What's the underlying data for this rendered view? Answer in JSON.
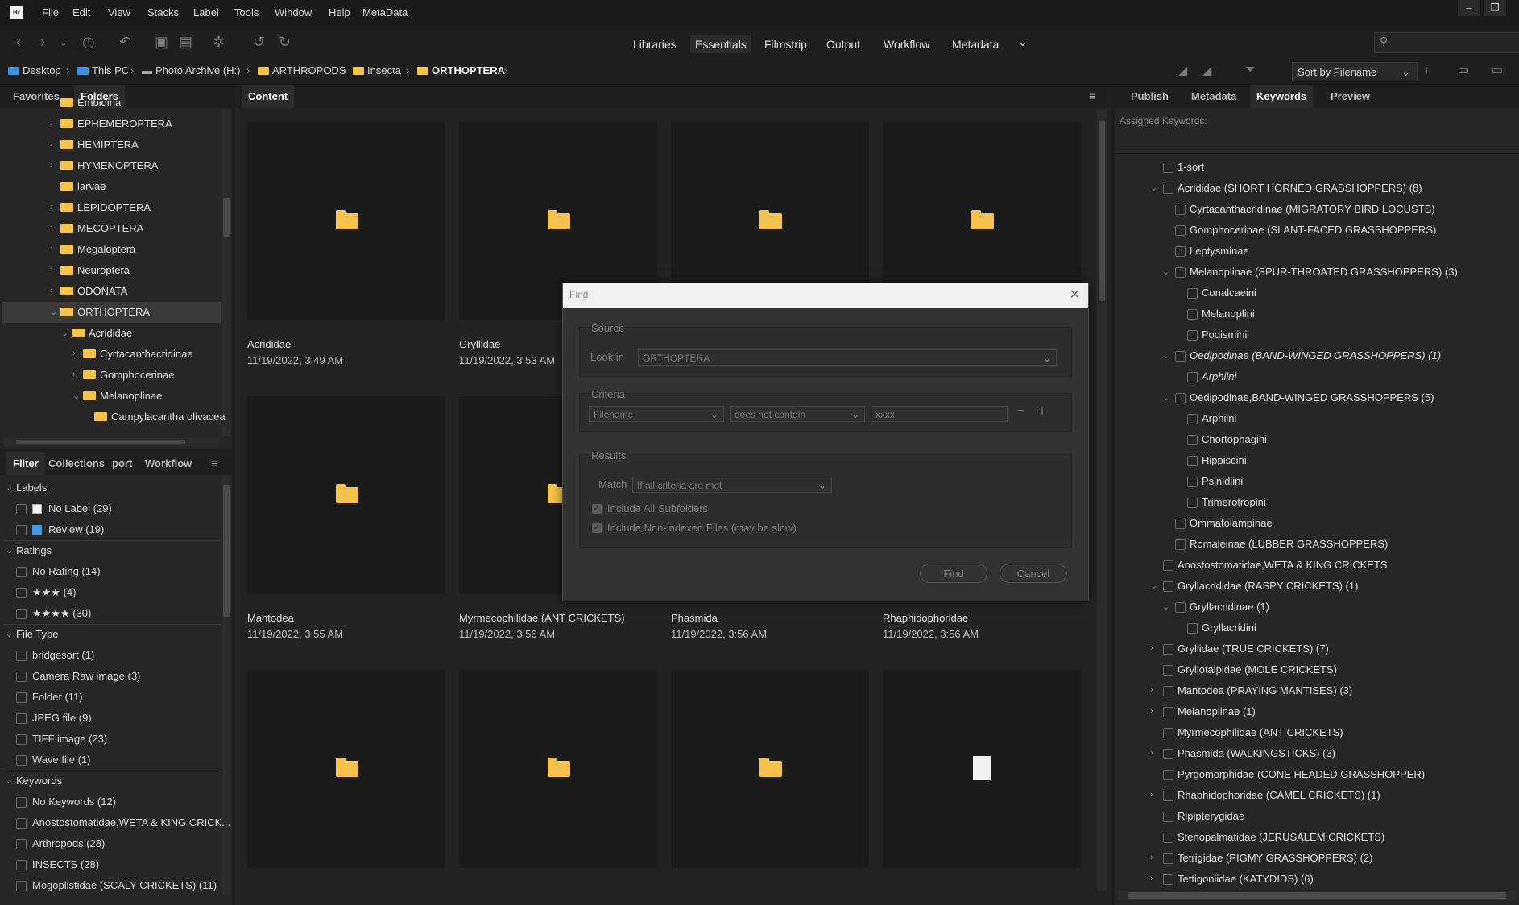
{
  "menu": [
    "File",
    "Edit",
    "View",
    "Stacks",
    "Label",
    "Tools",
    "Window",
    "Help",
    "MetaData"
  ],
  "app_logo": "Br",
  "workspaces": [
    "Libraries",
    "Essentials",
    "Filmstrip",
    "Output",
    "Workflow",
    "Metadata"
  ],
  "active_workspace": "Essentials",
  "breadcrumb": [
    "Desktop",
    "This PC",
    "Photo Archive (H:)",
    "ARTHROPODS",
    "Insecta",
    "ORTHOPTERA"
  ],
  "sort_label": "Sort by Filename",
  "left_top_tabs": [
    "Favorites",
    "Folders"
  ],
  "folders": [
    {
      "label": "Embidina",
      "indent": 0,
      "chev": ""
    },
    {
      "label": "EPHEMEROPTERA",
      "indent": 0,
      "chev": "›"
    },
    {
      "label": "HEMIPTERA",
      "indent": 0,
      "chev": "›"
    },
    {
      "label": "HYMENOPTERA",
      "indent": 0,
      "chev": "›"
    },
    {
      "label": "larvae",
      "indent": 0,
      "chev": ""
    },
    {
      "label": "LEPIDOPTERA",
      "indent": 0,
      "chev": "›"
    },
    {
      "label": "MECOPTERA",
      "indent": 0,
      "chev": "›"
    },
    {
      "label": "Megaloptera",
      "indent": 0,
      "chev": "›"
    },
    {
      "label": "Neuroptera",
      "indent": 0,
      "chev": "›"
    },
    {
      "label": "ODONATA",
      "indent": 0,
      "chev": "›"
    },
    {
      "label": "ORTHOPTERA",
      "indent": 0,
      "chev": "⌄",
      "selected": true
    },
    {
      "label": "Acrididae",
      "indent": 1,
      "chev": "⌄"
    },
    {
      "label": "Cyrtacanthacridinae",
      "indent": 2,
      "chev": "›"
    },
    {
      "label": "Gomphocerinae",
      "indent": 2,
      "chev": "›"
    },
    {
      "label": "Melanoplinae",
      "indent": 2,
      "chev": "⌄"
    },
    {
      "label": "Campylacantha olivacea",
      "indent": 3,
      "chev": ""
    }
  ],
  "left_bottom_tabs": [
    "Filter",
    "Collections",
    "port",
    "Workflow"
  ],
  "filter": [
    {
      "type": "section",
      "label": "Labels"
    },
    {
      "type": "item",
      "label": "No Label (29)",
      "swatch": "nolabel"
    },
    {
      "type": "item",
      "label": "Review (19)",
      "swatch": "#3d9be9"
    },
    {
      "type": "section",
      "label": "Ratings"
    },
    {
      "type": "item",
      "label": "No Rating (14)"
    },
    {
      "type": "item",
      "label": "★★★ (4)"
    },
    {
      "type": "item",
      "label": "★★★★ (30)"
    },
    {
      "type": "section",
      "label": "File Type"
    },
    {
      "type": "item",
      "label": "bridgesort (1)"
    },
    {
      "type": "item",
      "label": "Camera Raw image (3)"
    },
    {
      "type": "item",
      "label": "Folder (11)"
    },
    {
      "type": "item",
      "label": "JPEG file (9)"
    },
    {
      "type": "item",
      "label": "TIFF image (23)"
    },
    {
      "type": "item",
      "label": "Wave file (1)"
    },
    {
      "type": "section",
      "label": "Keywords"
    },
    {
      "type": "item",
      "label": "No Keywords (12)"
    },
    {
      "type": "item",
      "label": "Anostostomatidae,WETA & KING CRICK..."
    },
    {
      "type": "item",
      "label": "Arthropods (28)"
    },
    {
      "type": "item",
      "label": "INSECTS (28)"
    },
    {
      "type": "item",
      "label": "Mogoplistidae (SCALY CRICKETS) (11)"
    }
  ],
  "content_tab": "Content",
  "thumbnails": [
    {
      "name": "Acrididae",
      "date": "11/19/2022, 3:49 AM",
      "kind": "folder"
    },
    {
      "name": "Gryllidae",
      "date": "11/19/2022, 3:53 AM",
      "kind": "folder"
    },
    {
      "name": "",
      "date": "",
      "kind": "folder"
    },
    {
      "name": "",
      "date": "",
      "kind": "folder"
    },
    {
      "name": "Mantodea",
      "date": "11/19/2022, 3:55 AM",
      "kind": "folder"
    },
    {
      "name": "Myrmecophilidae (ANT CRICKETS)",
      "date": "11/19/2022, 3:56 AM",
      "kind": "folder"
    },
    {
      "name": "Phasmida",
      "date": "11/19/2022, 3:56 AM",
      "kind": "none"
    },
    {
      "name": "Rhaphidophoridae",
      "date": "11/19/2022, 3:56 AM",
      "kind": "none"
    },
    {
      "name": "",
      "date": "",
      "kind": "folder"
    },
    {
      "name": "",
      "date": "",
      "kind": "folder"
    },
    {
      "name": "",
      "date": "",
      "kind": "folder"
    },
    {
      "name": "",
      "date": "",
      "kind": "file"
    }
  ],
  "right_tabs": [
    "Publish",
    "Metadata",
    "Keywords",
    "Preview"
  ],
  "assigned_keywords_label": "Assigned Keywords:",
  "keywords": [
    {
      "label": "1-sort",
      "level": 0,
      "chev": ""
    },
    {
      "label": "Acrididae (SHORT HORNED GRASSHOPPERS) (8)",
      "level": 0,
      "chev": "⌄"
    },
    {
      "label": "Cyrtacanthacridinae (MIGRATORY BIRD LOCUSTS)",
      "level": 1,
      "chev": ""
    },
    {
      "label": "Gomphocerinae (SLANT-FACED GRASSHOPPERS)",
      "level": 1,
      "chev": ""
    },
    {
      "label": "Leptysminae",
      "level": 1,
      "chev": ""
    },
    {
      "label": "Melanoplinae (SPUR-THROATED GRASSHOPPERS) (3)",
      "level": 1,
      "chev": "⌄"
    },
    {
      "label": "Conalcaeini",
      "level": 2,
      "chev": ""
    },
    {
      "label": "Melanoplini",
      "level": 2,
      "chev": ""
    },
    {
      "label": "Podismini",
      "level": 2,
      "chev": ""
    },
    {
      "label": "Oedipodinae (BAND-WINGED GRASSHOPPERS) (1)",
      "level": 1,
      "chev": "⌄",
      "italic": true
    },
    {
      "label": "Arphiini",
      "level": 2,
      "chev": "",
      "italic": true
    },
    {
      "label": "Oedipodinae,BAND-WINGED GRASSHOPPERS (5)",
      "level": 1,
      "chev": "⌄"
    },
    {
      "label": "Arphiini",
      "level": 2,
      "chev": ""
    },
    {
      "label": "Chortophagini",
      "level": 2,
      "chev": ""
    },
    {
      "label": "Hippiscini",
      "level": 2,
      "chev": ""
    },
    {
      "label": "Psinidiini",
      "level": 2,
      "chev": ""
    },
    {
      "label": "Trimerotropini",
      "level": 2,
      "chev": ""
    },
    {
      "label": "Ommatolampinae",
      "level": 1,
      "chev": ""
    },
    {
      "label": "Romaleinae (LUBBER GRASSHOPPERS)",
      "level": 1,
      "chev": ""
    },
    {
      "label": "Anostostomatidae,WETA & KING CRICKETS",
      "level": 0,
      "chev": ""
    },
    {
      "label": "Gryllacrididae (RASPY CRICKETS) (1)",
      "level": 0,
      "chev": "⌄"
    },
    {
      "label": "Gryllacridinae (1)",
      "level": 1,
      "chev": "⌄"
    },
    {
      "label": "Gryllacridini",
      "level": 2,
      "chev": ""
    },
    {
      "label": "Gryllidae (TRUE CRICKETS) (7)",
      "level": 0,
      "chev": "›"
    },
    {
      "label": "Gryllotalpidae (MOLE CRICKETS)",
      "level": 0,
      "chev": ""
    },
    {
      "label": "Mantodea (PRAYING MANTISES) (3)",
      "level": 0,
      "chev": "›"
    },
    {
      "label": "Melanoplinae (1)",
      "level": 0,
      "chev": "›"
    },
    {
      "label": "Myrmecophilidae (ANT CRICKETS)",
      "level": 0,
      "chev": ""
    },
    {
      "label": "Phasmida (WALKINGSTICKS) (3)",
      "level": 0,
      "chev": "›"
    },
    {
      "label": "Pyrgomorphidae (CONE HEADED GRASSHOPPER)",
      "level": 0,
      "chev": ""
    },
    {
      "label": "Rhaphidophoridae (CAMEL CRICKETS) (1)",
      "level": 0,
      "chev": "›"
    },
    {
      "label": "Ripipterygidae",
      "level": 0,
      "chev": ""
    },
    {
      "label": "Stenopalmatidae (JERUSALEM CRICKETS)",
      "level": 0,
      "chev": ""
    },
    {
      "label": "Tetrigidae (PIGMY GRASSHOPPERS) (2)",
      "level": 0,
      "chev": "›"
    },
    {
      "label": "Tettigoniidae (KATYDIDS) (6)",
      "level": 0,
      "chev": "›"
    }
  ],
  "find_dialog": {
    "title": "Find",
    "source_legend": "Source",
    "look_in_label": "Look in",
    "look_in_value": "ORTHOPTERA",
    "criteria_legend": "Criteria",
    "criteria_field": "Filename",
    "criteria_op": "does not contain",
    "criteria_value": "xxxx",
    "results_legend": "Results",
    "match_label": "Match",
    "match_value": "If all criteria are met",
    "include_subfolders": "Include All Subfolders",
    "include_nonindexed": "Include Non-indexed Files (may be slow)",
    "find_button": "Find",
    "cancel_button": "Cancel"
  },
  "colors": {
    "folder": "#f5c24c",
    "accent_blue": "#3d8fe0",
    "review_label": "#3d9be9"
  }
}
